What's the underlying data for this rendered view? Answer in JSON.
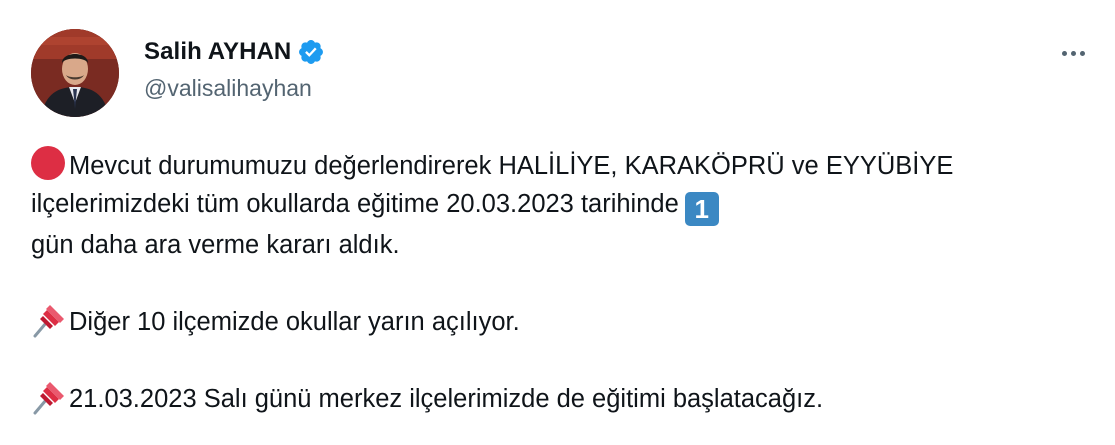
{
  "author": {
    "display_name": "Salih AYHAN",
    "handle": "@valisalihayhan",
    "verified": true,
    "avatar_icon": "profile-photo"
  },
  "tweet": {
    "line1_emoji": "red-circle",
    "para1": "Mevcut durumumuzu değerlendirerek HALİLİYE, KARAKÖPRÜ ve EYYÜBİYE ilçelerimizdeki tüm okullarda eğitime 20.03.2023 tarihinde",
    "keycap": "1",
    "para1_end": "gün daha ara verme kararı aldık.",
    "para2_emoji": "pushpin",
    "para2": "Diğer 10 ilçemizde okullar yarın açılıyor.",
    "para3_emoji": "pushpin",
    "para3": "21.03.2023 Salı günü merkez ilçelerimizde de eğitimi başlatacağız."
  },
  "colors": {
    "text": "#0f1419",
    "secondary": "#536471",
    "verified_blue": "#1d9bf0",
    "red_circle": "#dd2e44",
    "keycap_blue": "#3b88c3"
  }
}
